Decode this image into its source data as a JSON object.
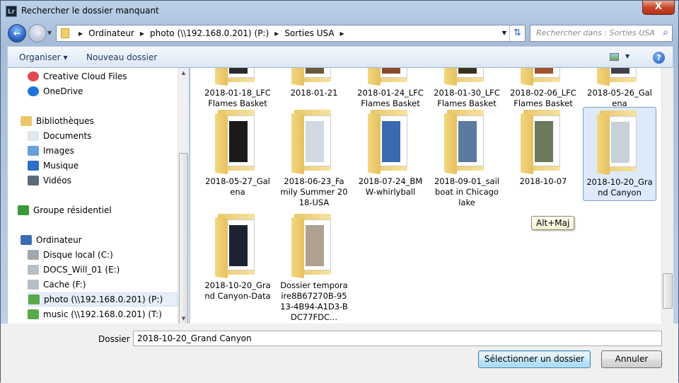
{
  "window": {
    "title": "Rechercher le dossier manquant",
    "app_icon": "Lr",
    "close_label": "X"
  },
  "address": {
    "crumbs": [
      "Ordinateur",
      "photo (\\\\192.168.0.201) (P:)",
      "Sorties USA"
    ],
    "search_placeholder": "Rechercher dans : Sorties USA"
  },
  "toolbar": {
    "organize": "Organiser ▾",
    "new_folder": "Nouveau dossier",
    "help": "?"
  },
  "nav": {
    "items": [
      {
        "label": "Creative Cloud Files",
        "icon": "creative-cloud-icon"
      },
      {
        "label": "OneDrive",
        "icon": "onedrive-icon"
      },
      {
        "label": "Bibliothèques",
        "icon": "libraries-icon"
      },
      {
        "label": "Documents",
        "icon": "documents-icon"
      },
      {
        "label": "Images",
        "icon": "images-icon"
      },
      {
        "label": "Musique",
        "icon": "music-icon"
      },
      {
        "label": "Vidéos",
        "icon": "videos-icon"
      },
      {
        "label": "Groupe résidentiel",
        "icon": "homegroup-icon"
      },
      {
        "label": "Ordinateur",
        "icon": "computer-icon"
      },
      {
        "label": "Disque local (C:)",
        "icon": "local-disk-icon"
      },
      {
        "label": "DOCS_Will_01 (E:)",
        "icon": "drive-icon"
      },
      {
        "label": "Cache (F:)",
        "icon": "drive-icon"
      },
      {
        "label": "photo (\\\\192.168.0.201) (P:)",
        "icon": "network-drive-icon",
        "selected": true
      },
      {
        "label": "music (\\\\192.168.0.201) (T:)",
        "icon": "network-drive-icon"
      }
    ]
  },
  "folders": [
    {
      "name": "2018-01-18_LFC Flames Basket"
    },
    {
      "name": "2018-01-21"
    },
    {
      "name": "2018-01-24_LFC Flames Basket"
    },
    {
      "name": "2018-01-30_LFC Flames Basket"
    },
    {
      "name": "2018-02-06_LFC Flames Basket"
    },
    {
      "name": "2018-05-26_Galena"
    },
    {
      "name": "2018-05-27_Galena"
    },
    {
      "name": "2018-06-23_Family Summer 2018-USA"
    },
    {
      "name": "2018-07-24_BMW-whirlyball"
    },
    {
      "name": "2018-09-01_sailboat in Chicago lake"
    },
    {
      "name": "2018-10-07"
    },
    {
      "name": "2018-10-20_Grand Canyon",
      "selected": true
    },
    {
      "name": "2018-10-20_Grand Canyon-Data"
    },
    {
      "name": "Dossier temporaire8B67270B-9513-4B94-A1D3-BDC77FDC..."
    }
  ],
  "tooltip": "Alt+Maj",
  "footer": {
    "folder_label": "Dossier :",
    "folder_value": "2018-10-20_Grand Canyon",
    "select_button": "Sélectionner un dossier",
    "cancel_button": "Annuler"
  },
  "colors": {
    "selection": "#dceafc",
    "folder": "#f3d780",
    "primary_button": "#bee6fd"
  }
}
